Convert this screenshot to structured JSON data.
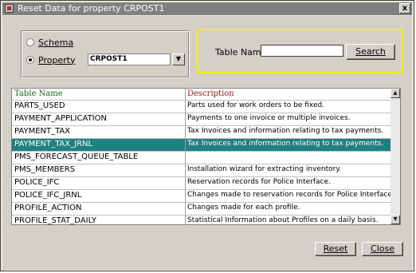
{
  "window": {
    "title": "Reset Data for property CRPOST1",
    "close_glyph": "x"
  },
  "scope": {
    "schema_label": "Schema",
    "property_label": "Property",
    "property_value": "CRPOST1",
    "selected": "property"
  },
  "search": {
    "label": "Table Name",
    "value": "",
    "button": "Search"
  },
  "table": {
    "columns": [
      "Table Name",
      "Description"
    ],
    "rows": [
      {
        "name": "PARTS_USED",
        "description": "Parts used for work orders to be fixed."
      },
      {
        "name": "PAYMENT_APPLICATION",
        "description": "Payments to one invoice or multiple invoices."
      },
      {
        "name": "PAYMENT_TAX",
        "description": "Tax Invoices and information relating to tax payments."
      },
      {
        "name": "PAYMENT_TAX_JRNL",
        "description": "Tax Invoices and information relating to tax payments."
      },
      {
        "name": "PMS_FORECAST_QUEUE_TABLE",
        "description": ""
      },
      {
        "name": "PMS_MEMBERS",
        "description": "Installation wizard for extracting inventory."
      },
      {
        "name": "POLICE_IFC",
        "description": "Reservation records for Police Interface."
      },
      {
        "name": "POLICE_IFC_JRNL",
        "description": "Changes made to reservation records for Police Interface."
      },
      {
        "name": "PROFILE_ACTION",
        "description": "Changes made for each profile."
      },
      {
        "name": "PROFILE_STAT_DAILY",
        "description": "Statistical Information about Profiles on a daily basis."
      }
    ],
    "selected_index": 3
  },
  "buttons": {
    "reset": "Reset",
    "close": "Close"
  },
  "colors": {
    "selection": "#1e8080",
    "highlight_border": "#f0f000",
    "header_name": "#1a6b1a",
    "header_desc": "#a01c1c"
  }
}
